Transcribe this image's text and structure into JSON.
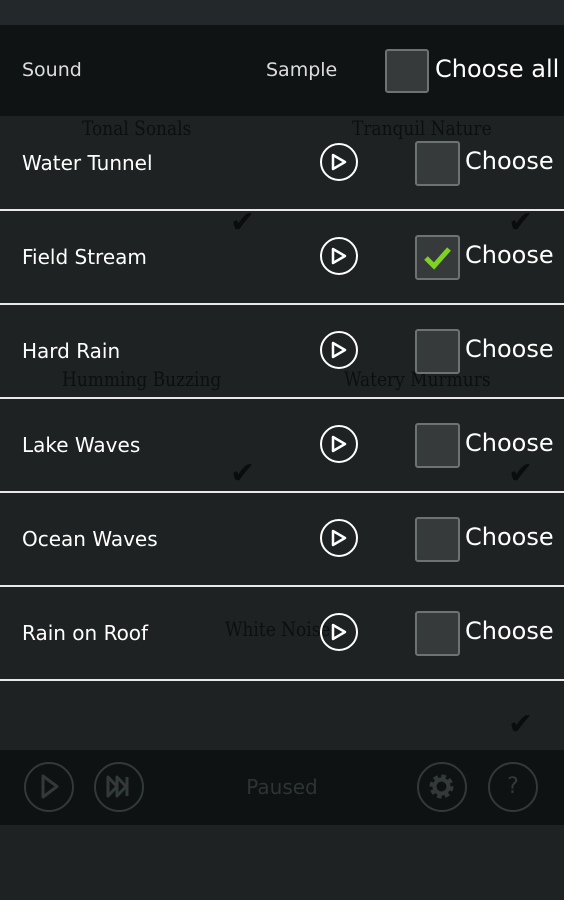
{
  "header": {
    "sound_label": "Sound",
    "sample_label": "Sample",
    "choose_all_label": "Choose all",
    "choose_all_checked": false
  },
  "background_labels": [
    "Tonal Sonals",
    "Tranquil Nature",
    "Humming Buzzing",
    "Watery Murmurs",
    "White Noise"
  ],
  "rows": [
    {
      "name": "Water Tunnel",
      "choose_label": "Choose",
      "checked": false
    },
    {
      "name": "Field Stream",
      "choose_label": "Choose",
      "checked": true
    },
    {
      "name": "Hard Rain",
      "choose_label": "Choose",
      "checked": false
    },
    {
      "name": "Lake Waves",
      "choose_label": "Choose",
      "checked": false
    },
    {
      "name": "Ocean Waves",
      "choose_label": "Choose",
      "checked": false
    },
    {
      "name": "Rain on Roof",
      "choose_label": "Choose",
      "checked": false
    }
  ],
  "player": {
    "status": "Paused",
    "help_label": "?"
  },
  "colors": {
    "check": "#7ed321",
    "background": "#1e2222",
    "bar": "#0f1212"
  }
}
